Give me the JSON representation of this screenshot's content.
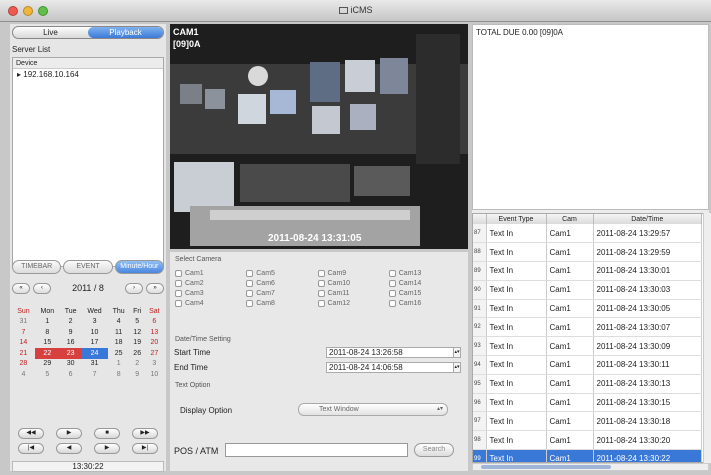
{
  "window": {
    "title": "iCMS",
    "traffic_colors": [
      "#ee5a50",
      "#f0b53a",
      "#5fc048"
    ]
  },
  "left_panel": {
    "mode_tabs": [
      {
        "label": "Live",
        "active": false
      },
      {
        "label": "Playback",
        "active": true
      }
    ],
    "server_list_label": "Server List",
    "device_header": "Device",
    "devices": [
      "▸ 192.168.10.164"
    ],
    "view_tabs": [
      {
        "label": "TIMEBAR",
        "active": false
      },
      {
        "label": "EVENT",
        "active": false
      },
      {
        "label": "Minute/Hour",
        "active": true
      }
    ],
    "calendar": {
      "title": "2011 / 8",
      "nav": [
        "«",
        "‹",
        "›",
        "»"
      ],
      "weekdays": [
        "Sun",
        "Mon",
        "Tue",
        "Wed",
        "Thu",
        "Fri",
        "Sat"
      ],
      "weeks": [
        [
          "31",
          "1",
          "2",
          "3",
          "4",
          "5",
          "6"
        ],
        [
          "7",
          "8",
          "9",
          "10",
          "11",
          "12",
          "13"
        ],
        [
          "14",
          "15",
          "16",
          "17",
          "18",
          "19",
          "20"
        ],
        [
          "21",
          "22",
          "23",
          "24",
          "25",
          "26",
          "27"
        ],
        [
          "28",
          "29",
          "30",
          "31",
          "1",
          "2",
          "3"
        ],
        [
          "4",
          "5",
          "6",
          "7",
          "8",
          "9",
          "10"
        ]
      ],
      "recorded_days": [
        "22",
        "23"
      ],
      "selected_day": "24"
    },
    "playback_controls_row1": [
      "◀◀",
      "▶",
      "■",
      "▶▶"
    ],
    "playback_controls_row2": [
      "|◀",
      "◀",
      "▶",
      "▶|"
    ],
    "current_time": "13:30:22"
  },
  "video": {
    "camera_name": "CAM1",
    "overlay_text": "[09]0A",
    "timestamp": "2011-08-24 13:31:05"
  },
  "controls": {
    "select_camera_label": "Select Camera",
    "cameras": [
      "Cam1",
      "Cam5",
      "Cam9",
      "Cam13",
      "Cam2",
      "Cam6",
      "Cam10",
      "Cam14",
      "Cam3",
      "Cam7",
      "Cam11",
      "Cam15",
      "Cam4",
      "Cam8",
      "Cam12",
      "Cam16"
    ],
    "datetime_label": "Date/Time Setting",
    "start_time_label": "Start Time",
    "start_time": "2011-08-24 13:26:58",
    "end_time_label": "End Time",
    "end_time": "2011-08-24 14:06:58",
    "text_option_label": "Text Option",
    "display_option_label": "Display Option",
    "display_option_value": "Text Window",
    "pos_label": "POS / ATM",
    "pos_value": "",
    "search_label": "Search"
  },
  "text_window": {
    "content": "TOTAL DUE 0.00 [09]0A"
  },
  "events": {
    "columns": [
      "",
      "Event Type",
      "Cam",
      "Date/Time"
    ],
    "rows": [
      {
        "num": "87",
        "type": "Text In",
        "cam": "Cam1",
        "datetime": "2011-08-24 13:29:57"
      },
      {
        "num": "88",
        "type": "Text In",
        "cam": "Cam1",
        "datetime": "2011-08-24 13:29:59"
      },
      {
        "num": "89",
        "type": "Text In",
        "cam": "Cam1",
        "datetime": "2011-08-24 13:30:01"
      },
      {
        "num": "90",
        "type": "Text In",
        "cam": "Cam1",
        "datetime": "2011-08-24 13:30:03"
      },
      {
        "num": "91",
        "type": "Text In",
        "cam": "Cam1",
        "datetime": "2011-08-24 13:30:05"
      },
      {
        "num": "92",
        "type": "Text In",
        "cam": "Cam1",
        "datetime": "2011-08-24 13:30:07"
      },
      {
        "num": "93",
        "type": "Text In",
        "cam": "Cam1",
        "datetime": "2011-08-24 13:30:09"
      },
      {
        "num": "94",
        "type": "Text In",
        "cam": "Cam1",
        "datetime": "2011-08-24 13:30:11"
      },
      {
        "num": "95",
        "type": "Text In",
        "cam": "Cam1",
        "datetime": "2011-08-24 13:30:13"
      },
      {
        "num": "96",
        "type": "Text In",
        "cam": "Cam1",
        "datetime": "2011-08-24 13:30:15"
      },
      {
        "num": "97",
        "type": "Text In",
        "cam": "Cam1",
        "datetime": "2011-08-24 13:30:18"
      },
      {
        "num": "98",
        "type": "Text In",
        "cam": "Cam1",
        "datetime": "2011-08-24 13:30:20"
      },
      {
        "num": "99",
        "type": "Text In",
        "cam": "Cam1",
        "datetime": "2011-08-24 13:30:22"
      }
    ],
    "selected_num": "99"
  },
  "colors": {
    "accent": "#3a78d8",
    "recorded_day": "#d84040"
  }
}
